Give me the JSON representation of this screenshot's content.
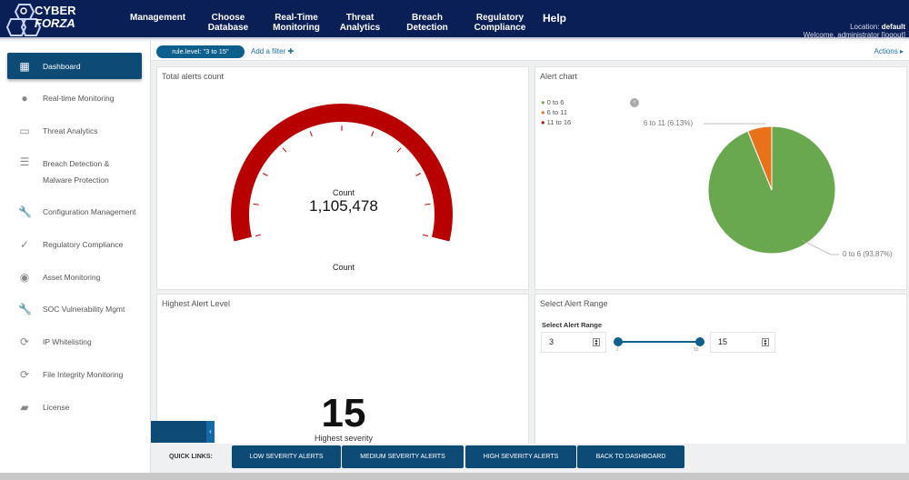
{
  "header": {
    "logo_line1": "CYBER",
    "logo_line2": "FORZA",
    "nav": [
      "Management",
      "Choose Database",
      "Real-Time Monitoring",
      "Threat Analytics",
      "Breach Detection",
      "Regulatory Compliance"
    ],
    "help": "Help",
    "location_label": "Location:",
    "location_value": "default",
    "welcome": "Welcome, administrator",
    "logout": "[logout]"
  },
  "sidebar": {
    "items": [
      {
        "label": "Dashboard",
        "icon": "dashboard-icon"
      },
      {
        "label": "Real-time Monitoring",
        "icon": "user-icon"
      },
      {
        "label": "Threat Analytics",
        "icon": "clipboard-icon"
      },
      {
        "label": "Breach Detection &",
        "label2": "Malware Protection",
        "icon": "list-icon"
      },
      {
        "label": "Configuration Management",
        "icon": "wrench-icon"
      },
      {
        "label": "Regulatory Compliance",
        "icon": "check-circle-icon"
      },
      {
        "label": "Asset Monitoring",
        "icon": "eye-icon"
      },
      {
        "label": "SOC Vulnerability Mgmt",
        "icon": "wrench-icon"
      },
      {
        "label": "IP Whitelisting",
        "icon": "search-refresh-icon"
      },
      {
        "label": "File Integrity Monitoring",
        "icon": "search-refresh-icon"
      },
      {
        "label": "License",
        "icon": "license-icon"
      }
    ]
  },
  "filters": {
    "active": "rule.level: \"3 to 15\"",
    "add": "Add a filter ✚",
    "actions": "Actions ▸"
  },
  "panels": {
    "total": {
      "title": "Total alerts count",
      "center_label": "Count",
      "value": "1,105,478",
      "bottom_label": "Count",
      "color": "#b80000"
    },
    "alert_chart": {
      "title": "Alert chart",
      "legend": [
        {
          "label": "0 to 6",
          "color": "#6aa84f"
        },
        {
          "label": "6 to 11",
          "color": "#e8711a"
        },
        {
          "label": "11 to 16",
          "color": "#b30000"
        }
      ],
      "slices": [
        {
          "label": "0 to 6 (93.87%)",
          "value": 93.87
        },
        {
          "label": "6 to 11 (6.13%)",
          "value": 6.13
        }
      ]
    },
    "highest": {
      "title": "Highest Alert Level",
      "value": "15",
      "label": "Highest severity"
    },
    "range": {
      "title": "Select Alert Range",
      "label": "Select Alert Range",
      "min_value": "3",
      "max_value": "15",
      "slider_min": "1",
      "slider_max": "15"
    }
  },
  "quick_links": {
    "label": "QUICK LINKS:",
    "buttons": [
      "LOW SEVERITY ALERTS",
      "MEDIUM SEVERITY ALERTS",
      "HIGH SEVERITY ALERTS",
      "BACK TO DASHBOARD"
    ]
  }
}
